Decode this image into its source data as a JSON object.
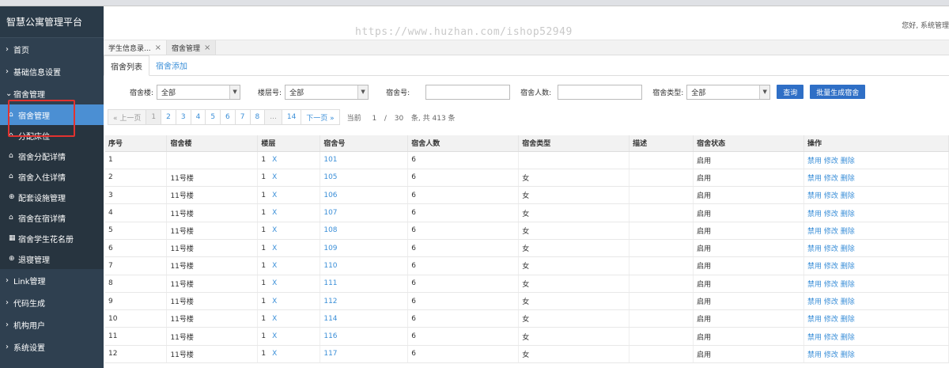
{
  "brand": "智慧公寓管理平台",
  "nav": [
    {
      "label": "首页",
      "expanded": false
    },
    {
      "label": "基础信息设置",
      "expanded": false
    },
    {
      "label": "宿舍管理",
      "expanded": true
    }
  ],
  "subnav": [
    {
      "label": "宿舍管理",
      "icon": "home-icon",
      "glyph": "⌂"
    },
    {
      "label": "分配床位",
      "icon": "home-icon",
      "glyph": "⌂"
    },
    {
      "label": "宿舍分配详情",
      "icon": "home-icon",
      "glyph": "⌂"
    },
    {
      "label": "宿舍入住详情",
      "icon": "home-icon",
      "glyph": "⌂"
    },
    {
      "label": "配套设施管理",
      "icon": "plus-circle-icon",
      "glyph": "⊕"
    },
    {
      "label": "宿舍在宿详情",
      "icon": "home-icon",
      "glyph": "⌂"
    },
    {
      "label": "宿舍学生花名册",
      "icon": "chart-icon",
      "glyph": "▦"
    },
    {
      "label": "退寝管理",
      "icon": "plus-circle-icon",
      "glyph": "⊕"
    }
  ],
  "nav_bottom": [
    {
      "label": "Link管理"
    },
    {
      "label": "代码生成"
    },
    {
      "label": "机构用户"
    },
    {
      "label": "系统设置"
    }
  ],
  "watermark": "https://www.huzhan.com/ishop52949",
  "greeting": "您好, 系统管理",
  "tabs": [
    {
      "label": "学生信息录...",
      "close": "×"
    },
    {
      "label": "宿舍管理",
      "close": "×"
    }
  ],
  "subtabs": {
    "list": "宿舍列表",
    "add": "宿舍添加"
  },
  "filters": {
    "building_label": "宿舍楼:",
    "building_value": "全部",
    "floor_label": "楼层号:",
    "floor_value": "全部",
    "room_label": "宿舍号:",
    "room_value": "",
    "capacity_label": "宿舍人数:",
    "capacity_value": "",
    "type_label": "宿舍类型:",
    "type_value": "全部",
    "query_button": "查询",
    "batch_button": "批量生成宿舍"
  },
  "pager": {
    "prev": "« 上一页",
    "pages": [
      "1",
      "2",
      "3",
      "4",
      "5",
      "6",
      "7",
      "8",
      "...",
      "14"
    ],
    "next": "下一页 »",
    "current_label": "当前",
    "current": "1",
    "sep": "/",
    "total_pages": "30",
    "suffix": "条, 共 413 条"
  },
  "table": {
    "headers": [
      "序号",
      "宿舍楼",
      "楼层",
      "宿舍号",
      "宿舍人数",
      "宿舍类型",
      "描述",
      "宿舍状态",
      "操作"
    ],
    "actions": [
      "禁用",
      "修改",
      "删除"
    ],
    "rows": [
      {
        "no": "1",
        "building": "",
        "floor": "1",
        "x": "X",
        "room": "101",
        "count": "6",
        "type": "",
        "desc": "",
        "status": "启用"
      },
      {
        "no": "2",
        "building": "11号楼",
        "floor": "1",
        "x": "X",
        "room": "105",
        "count": "6",
        "type": "女",
        "desc": "",
        "status": "启用"
      },
      {
        "no": "3",
        "building": "11号楼",
        "floor": "1",
        "x": "X",
        "room": "106",
        "count": "6",
        "type": "女",
        "desc": "",
        "status": "启用"
      },
      {
        "no": "4",
        "building": "11号楼",
        "floor": "1",
        "x": "X",
        "room": "107",
        "count": "6",
        "type": "女",
        "desc": "",
        "status": "启用"
      },
      {
        "no": "5",
        "building": "11号楼",
        "floor": "1",
        "x": "X",
        "room": "108",
        "count": "6",
        "type": "女",
        "desc": "",
        "status": "启用"
      },
      {
        "no": "6",
        "building": "11号楼",
        "floor": "1",
        "x": "X",
        "room": "109",
        "count": "6",
        "type": "女",
        "desc": "",
        "status": "启用"
      },
      {
        "no": "7",
        "building": "11号楼",
        "floor": "1",
        "x": "X",
        "room": "110",
        "count": "6",
        "type": "女",
        "desc": "",
        "status": "启用"
      },
      {
        "no": "8",
        "building": "11号楼",
        "floor": "1",
        "x": "X",
        "room": "111",
        "count": "6",
        "type": "女",
        "desc": "",
        "status": "启用"
      },
      {
        "no": "9",
        "building": "11号楼",
        "floor": "1",
        "x": "X",
        "room": "112",
        "count": "6",
        "type": "女",
        "desc": "",
        "status": "启用"
      },
      {
        "no": "10",
        "building": "11号楼",
        "floor": "1",
        "x": "X",
        "room": "114",
        "count": "6",
        "type": "女",
        "desc": "",
        "status": "启用"
      },
      {
        "no": "11",
        "building": "11号楼",
        "floor": "1",
        "x": "X",
        "room": "116",
        "count": "6",
        "type": "女",
        "desc": "",
        "status": "启用"
      },
      {
        "no": "12",
        "building": "11号楼",
        "floor": "1",
        "x": "X",
        "room": "117",
        "count": "6",
        "type": "女",
        "desc": "",
        "status": "启用"
      }
    ]
  }
}
